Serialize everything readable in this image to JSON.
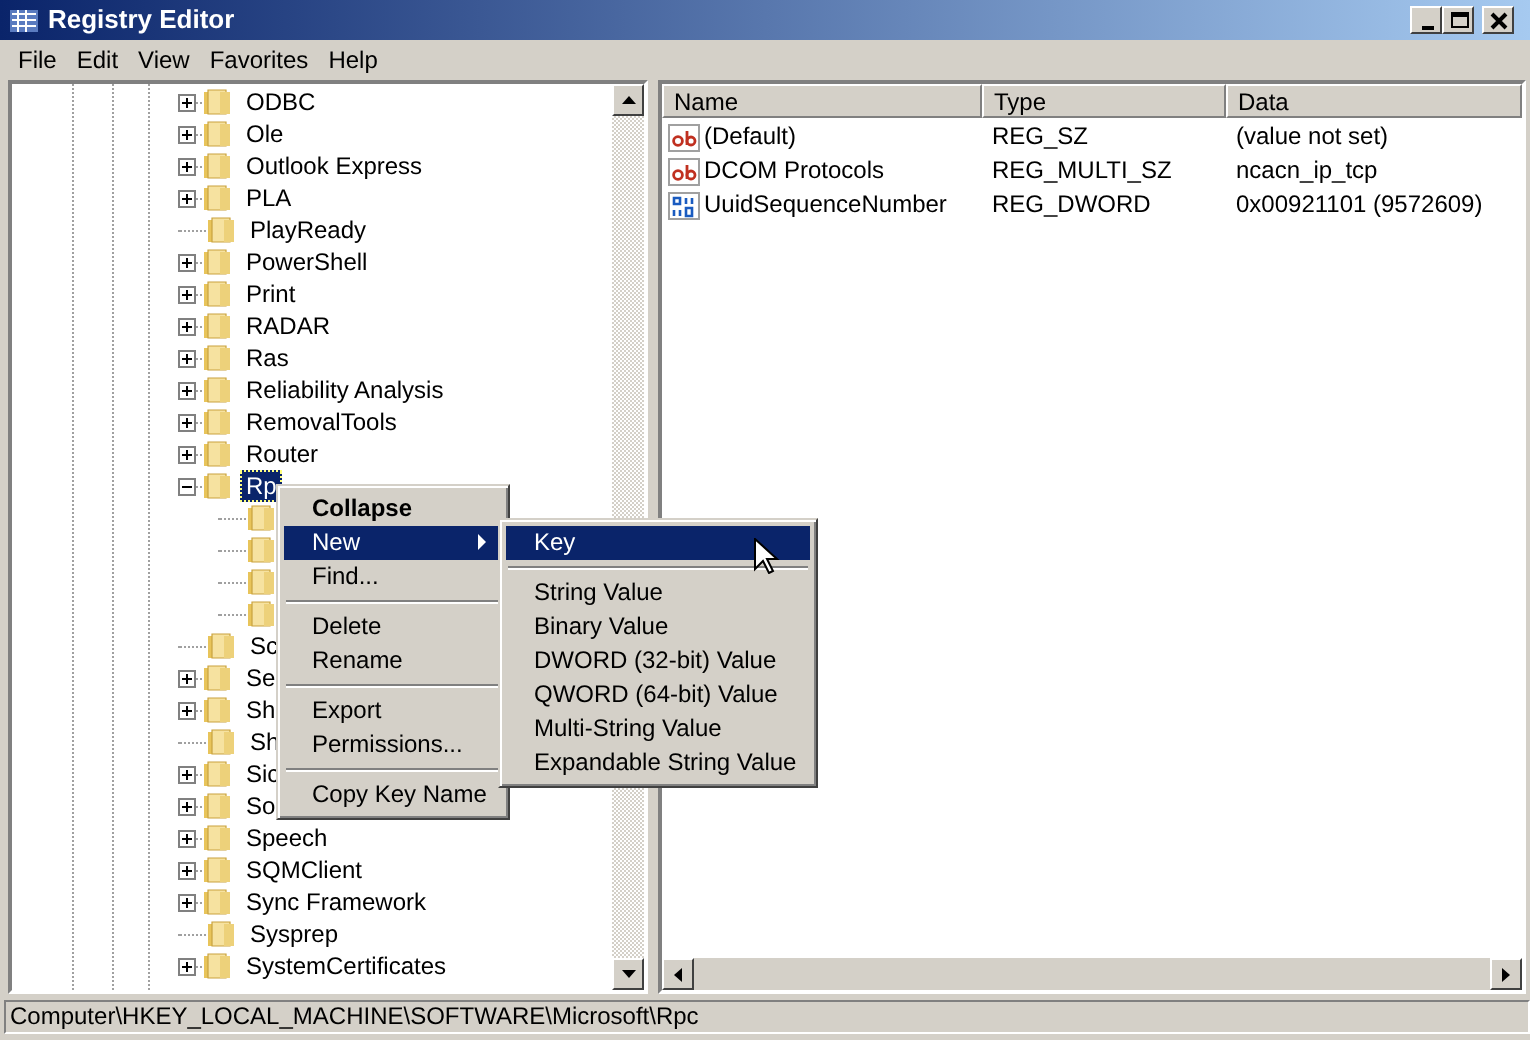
{
  "window": {
    "title": "Registry Editor"
  },
  "menu": [
    "File",
    "Edit",
    "View",
    "Favorites",
    "Help"
  ],
  "tree": [
    {
      "label": "ODBC",
      "has_children": true,
      "expanded": false,
      "selected": false
    },
    {
      "label": "Ole",
      "has_children": true,
      "expanded": false,
      "selected": false
    },
    {
      "label": "Outlook Express",
      "has_children": true,
      "expanded": false,
      "selected": false
    },
    {
      "label": "PLA",
      "has_children": true,
      "expanded": false,
      "selected": false
    },
    {
      "label": "PlayReady",
      "has_children": false,
      "selected": false
    },
    {
      "label": "PowerShell",
      "has_children": true,
      "expanded": false,
      "selected": false
    },
    {
      "label": "Print",
      "has_children": true,
      "expanded": false,
      "selected": false
    },
    {
      "label": "RADAR",
      "has_children": true,
      "expanded": false,
      "selected": false
    },
    {
      "label": "Ras",
      "has_children": true,
      "expanded": false,
      "selected": false
    },
    {
      "label": "Reliability Analysis",
      "has_children": true,
      "expanded": false,
      "selected": false
    },
    {
      "label": "RemovalTools",
      "has_children": true,
      "expanded": false,
      "selected": false
    },
    {
      "label": "Router",
      "has_children": true,
      "expanded": false,
      "selected": false
    },
    {
      "label": "Rp",
      "has_children": true,
      "expanded": true,
      "selected": true,
      "children": [
        {
          "has_children": false
        },
        {
          "has_children": false
        },
        {
          "has_children": false
        },
        {
          "has_children": false
        }
      ]
    },
    {
      "label": "Sc",
      "has_children": false,
      "selected": false
    },
    {
      "label": "Se",
      "has_children": true,
      "expanded": false,
      "selected": false
    },
    {
      "label": "Sh",
      "has_children": true,
      "expanded": false,
      "selected": false
    },
    {
      "label": "Sh",
      "has_children": false,
      "selected": false
    },
    {
      "label": "Sic",
      "has_children": true,
      "expanded": false,
      "selected": false
    },
    {
      "label": "So",
      "has_children": true,
      "expanded": false,
      "selected": false
    },
    {
      "label": "Speech",
      "has_children": true,
      "expanded": false,
      "selected": false
    },
    {
      "label": "SQMClient",
      "has_children": true,
      "expanded": false,
      "selected": false
    },
    {
      "label": "Sync Framework",
      "has_children": true,
      "expanded": false,
      "selected": false
    },
    {
      "label": "Sysprep",
      "has_children": false,
      "selected": false
    },
    {
      "label": "SystemCertificates",
      "has_children": true,
      "expanded": false,
      "selected": false
    }
  ],
  "values": {
    "columns": [
      "Name",
      "Type",
      "Data"
    ],
    "rows": [
      {
        "kind": "string",
        "name": "(Default)",
        "type": "REG_SZ",
        "data": "(value not set)"
      },
      {
        "kind": "string",
        "name": "DCOM Protocols",
        "type": "REG_MULTI_SZ",
        "data": "ncacn_ip_tcp"
      },
      {
        "kind": "binary",
        "name": "UuidSequenceNumber",
        "type": "REG_DWORD",
        "data": "0x00921101 (9572609)"
      }
    ]
  },
  "context_menu": [
    {
      "kind": "item",
      "label": "Collapse",
      "default": true,
      "selected": false,
      "submenu": false
    },
    {
      "kind": "item",
      "label": "New",
      "default": false,
      "selected": true,
      "submenu": true
    },
    {
      "kind": "item",
      "label": "Find...",
      "default": false,
      "selected": false,
      "submenu": false
    },
    {
      "kind": "separator"
    },
    {
      "kind": "item",
      "label": "Delete",
      "default": false,
      "selected": false,
      "submenu": false
    },
    {
      "kind": "item",
      "label": "Rename",
      "default": false,
      "selected": false,
      "submenu": false
    },
    {
      "kind": "separator"
    },
    {
      "kind": "item",
      "label": "Export",
      "default": false,
      "selected": false,
      "submenu": false
    },
    {
      "kind": "item",
      "label": "Permissions...",
      "default": false,
      "selected": false,
      "submenu": false
    },
    {
      "kind": "separator"
    },
    {
      "kind": "item",
      "label": "Copy Key Name",
      "default": false,
      "selected": false,
      "submenu": false
    }
  ],
  "submenu": [
    {
      "kind": "item",
      "label": "Key",
      "selected": true
    },
    {
      "kind": "separator"
    },
    {
      "kind": "item",
      "label": "String Value",
      "selected": false
    },
    {
      "kind": "item",
      "label": "Binary Value",
      "selected": false
    },
    {
      "kind": "item",
      "label": "DWORD (32-bit) Value",
      "selected": false
    },
    {
      "kind": "item",
      "label": "QWORD (64-bit) Value",
      "selected": false
    },
    {
      "kind": "item",
      "label": "Multi-String Value",
      "selected": false
    },
    {
      "kind": "item",
      "label": "Expandable String Value",
      "selected": false
    }
  ],
  "status_bar": "Computer\\HKEY_LOCAL_MACHINE\\SOFTWARE\\Microsoft\\Rpc"
}
